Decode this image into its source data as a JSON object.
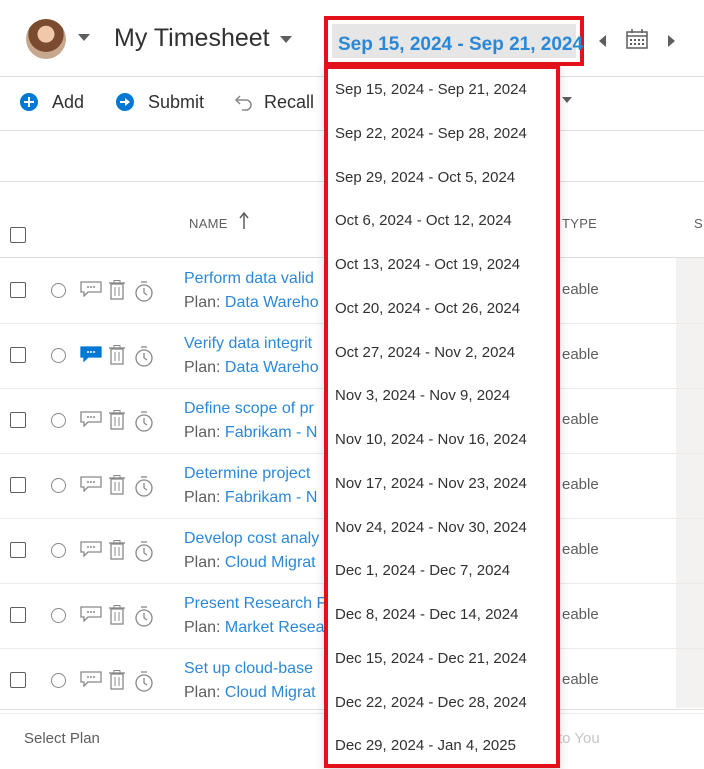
{
  "header": {
    "title": "My Timesheet",
    "date_range": "Sep 15, 2024 - Sep 21, 2024",
    "icons": [
      "avatar",
      "chevron-down-icon",
      "chevron-left-icon",
      "calendar-icon",
      "chevron-right-icon"
    ]
  },
  "toolbar": {
    "add_label": "Add",
    "submit_label": "Submit",
    "recall_label": "Recall"
  },
  "table": {
    "columns": {
      "name": "NAME",
      "type": "TYPE",
      "extra": "SU"
    },
    "rows": [
      {
        "task": "Perform data valid",
        "plan_prefix": "Plan:",
        "plan": "Data Wareho",
        "type": "eable"
      },
      {
        "task": "Verify data integrit",
        "plan_prefix": "Plan:",
        "plan": "Data Wareho",
        "type": "eable"
      },
      {
        "task": "Define scope of pr",
        "plan_prefix": "Plan:",
        "plan": "Fabrikam - N",
        "type": "eable"
      },
      {
        "task": "Determine project",
        "plan_prefix": "Plan:",
        "plan": "Fabrikam - N",
        "type": "eable"
      },
      {
        "task": "Develop cost analy",
        "plan_prefix": "Plan:",
        "plan": "Cloud Migrat",
        "type": "eable"
      },
      {
        "task": "Present Research F",
        "plan_prefix": "Plan:",
        "plan": "Market Resea",
        "type": "eable"
      },
      {
        "task": "Set up cloud-base",
        "plan_prefix": "Plan:",
        "plan": "Cloud Migrat",
        "type": "eable"
      }
    ]
  },
  "footer": {
    "select_plan": "Select Plan",
    "faded": "to You"
  },
  "dropdown": {
    "items": [
      "Sep 15, 2024 - Sep 21, 2024",
      "Sep 22, 2024 - Sep 28, 2024",
      "Sep 29, 2024 - Oct 5, 2024",
      "Oct 6, 2024 - Oct 12, 2024",
      "Oct 13, 2024 - Oct 19, 2024",
      "Oct 20, 2024 - Oct 26, 2024",
      "Oct 27, 2024 - Nov 2, 2024",
      "Nov 3, 2024 - Nov 9, 2024",
      "Nov 10, 2024 - Nov 16, 2024",
      "Nov 17, 2024 - Nov 23, 2024",
      "Nov 24, 2024 - Nov 30, 2024",
      "Dec 1, 2024 - Dec 7, 2024",
      "Dec 8, 2024 - Dec 14, 2024",
      "Dec 15, 2024 - Dec 21, 2024",
      "Dec 22, 2024 - Dec 28, 2024",
      "Dec 29, 2024 - Jan 4, 2025"
    ]
  },
  "colors": {
    "accent": "#2b88d8",
    "highlight_border": "#e3121a",
    "primary_blue": "#0078d4"
  }
}
